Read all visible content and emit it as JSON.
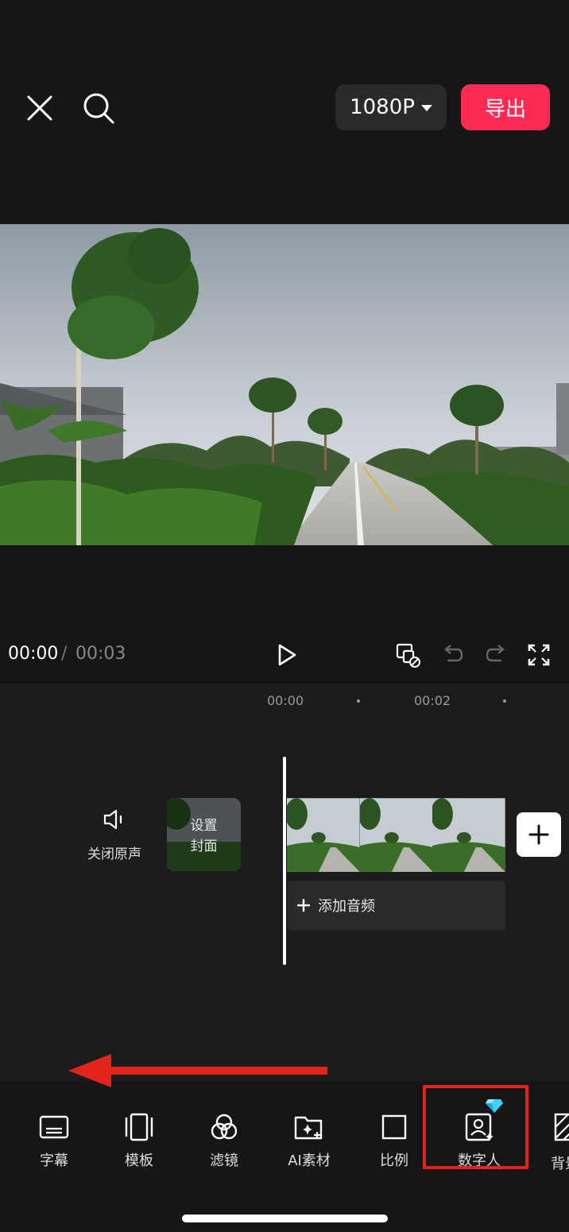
{
  "top_bar": {
    "close_icon": "close-icon",
    "search_icon": "search-icon",
    "resolution_label": "1080P",
    "export_label": "导出",
    "export_color": "#fe2c55"
  },
  "playback": {
    "current_time": "00:00",
    "separator": "/",
    "total_time": "00:03",
    "play_icon": "play-icon",
    "keyframe_icon": "keyframe-icon",
    "undo_icon": "undo-icon",
    "redo_icon": "redo-icon",
    "fullscreen_icon": "fullscreen-icon"
  },
  "timeline": {
    "ruler": [
      "00:00",
      "00:02"
    ],
    "mute_label": "关闭原声",
    "cover_label_line1": "设置",
    "cover_label_line2": "封面",
    "add_audio_label": "添加音频"
  },
  "toolbar": {
    "items": [
      {
        "label": "字幕",
        "icon": "subtitle-icon"
      },
      {
        "label": "模板",
        "icon": "template-icon"
      },
      {
        "label": "滤镜",
        "icon": "filter-icon"
      },
      {
        "label": "AI素材",
        "icon": "ai-material-icon"
      },
      {
        "label": "比例",
        "icon": "ratio-icon"
      },
      {
        "label": "数字人",
        "icon": "digital-human-icon"
      },
      {
        "label": "背景",
        "icon": "background-icon"
      }
    ],
    "premium_badge_icon": "diamond-icon"
  },
  "annotation": {
    "arrow_color": "#e3241c",
    "highlight_color": "#e3241c"
  }
}
